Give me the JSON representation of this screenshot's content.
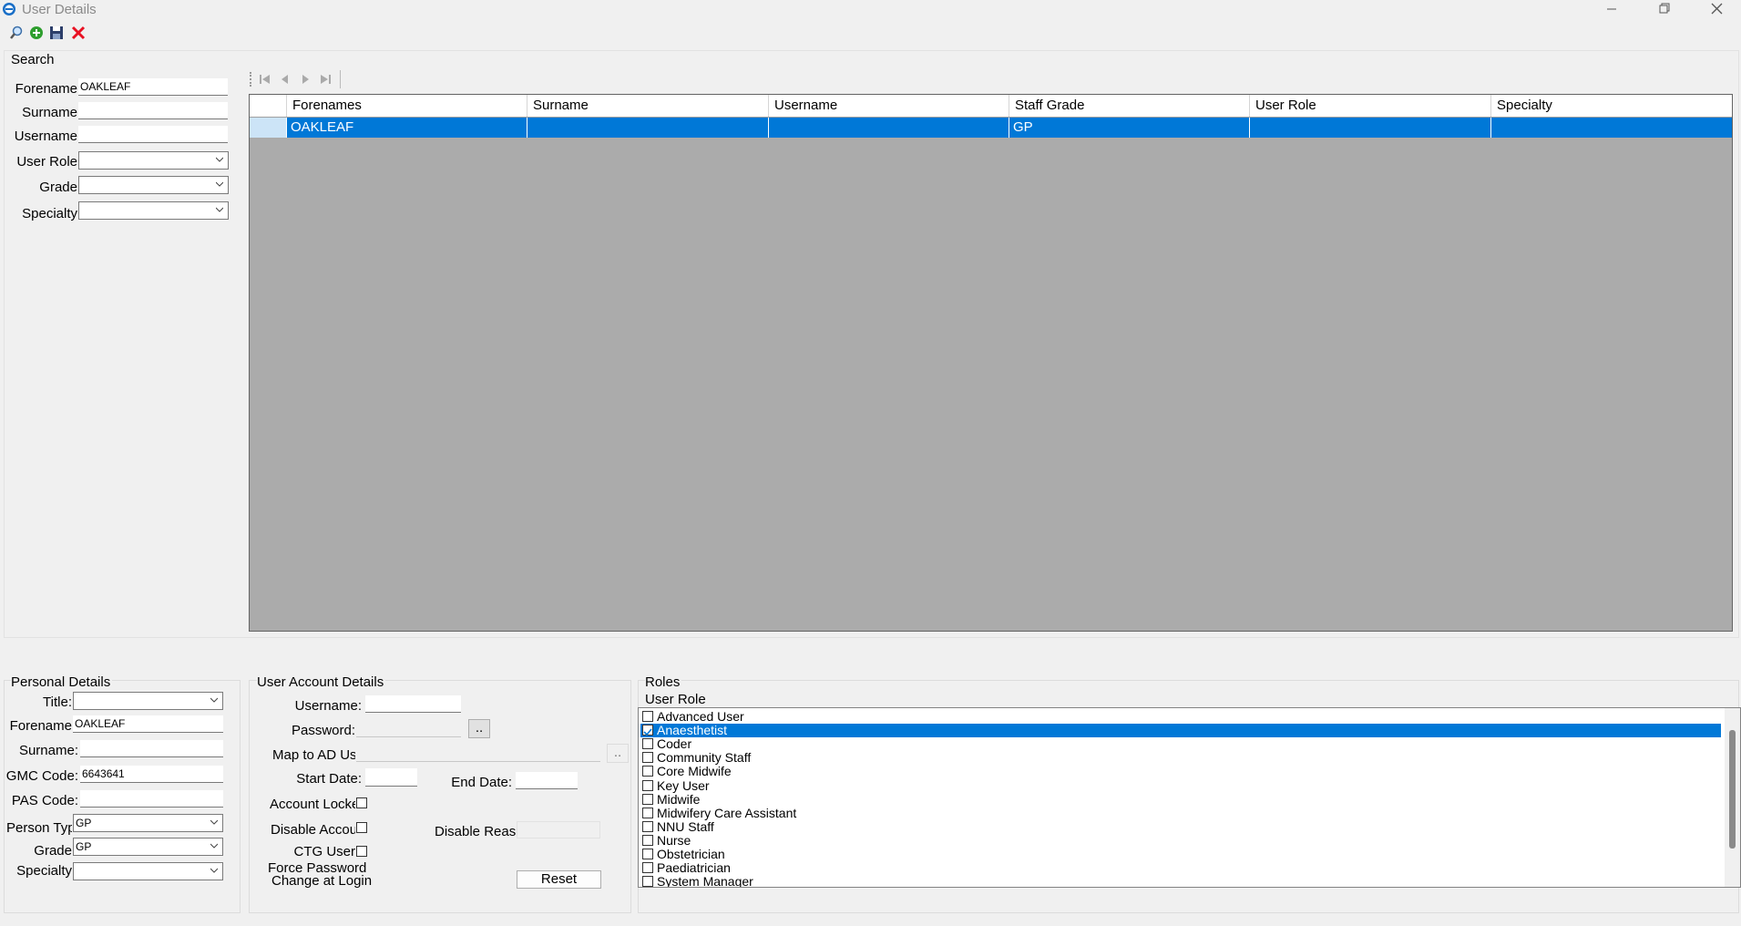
{
  "window": {
    "title": "User Details"
  },
  "search": {
    "title": "Search",
    "forename_label": "Forename",
    "forename_value": "OAKLEAF",
    "surname_label": "Surname",
    "surname_value": "",
    "username_label": "Username",
    "username_value": "",
    "user_role_label": "User Role",
    "user_role_value": "",
    "grade_label": "Grade",
    "grade_value": "",
    "specialty_label": "Specialty",
    "specialty_value": ""
  },
  "grid": {
    "columns": [
      "Forenames",
      "Surname",
      "Username",
      "Staff Grade",
      "User Role",
      "Specialty"
    ],
    "rows": [
      {
        "forenames": "OAKLEAF",
        "surname": "",
        "username": "",
        "staff_grade": "GP",
        "user_role": "",
        "specialty": ""
      }
    ]
  },
  "personal": {
    "title": "Personal Details",
    "title_label": "Title:",
    "title_value": "",
    "forename_label": "Forename",
    "forename_value": "OAKLEAF",
    "surname_label": "Surname:",
    "surname_value": "",
    "gmc_label": "GMC Code:",
    "gmc_value": "6643641",
    "pas_label": "PAS Code:",
    "pas_value": "",
    "person_type_label": "Person Type",
    "person_type_value": "GP",
    "grade_label": "Grade",
    "grade_value": "GP",
    "specialty_label": "Specialty",
    "specialty_value": ""
  },
  "account": {
    "title": "User Account Details",
    "username_label": "Username:",
    "username_value": "",
    "password_label": "Password:",
    "password_value": "",
    "password_btn": "..",
    "map_ad_label": "Map to AD User",
    "map_ad_value": "",
    "map_ad_btn": "..",
    "start_label": "Start Date:",
    "start_value": "",
    "end_label": "End Date:",
    "end_value": "",
    "locked_label": "Account Locked",
    "disable_label": "Disable Account",
    "disable_reason_label": "Disable Reason",
    "disable_reason_value": "",
    "ctg_label": "CTG User",
    "force_line1": "Force Password",
    "force_line2": "Change at Login:",
    "reset_btn": "Reset"
  },
  "roles": {
    "title": "Roles",
    "subtitle": "User Role",
    "items": [
      {
        "label": "Advanced User",
        "checked": false
      },
      {
        "label": "Anaesthetist",
        "checked": true
      },
      {
        "label": "Coder",
        "checked": false
      },
      {
        "label": "Community Staff",
        "checked": false
      },
      {
        "label": "Core Midwife",
        "checked": false
      },
      {
        "label": "Key User",
        "checked": false
      },
      {
        "label": "Midwife",
        "checked": false
      },
      {
        "label": "Midwifery Care Assistant",
        "checked": false
      },
      {
        "label": "NNU Staff",
        "checked": false
      },
      {
        "label": "Nurse",
        "checked": false
      },
      {
        "label": "Obstetrician",
        "checked": false
      },
      {
        "label": "Paediatrician",
        "checked": false
      },
      {
        "label": "System Manager",
        "checked": false
      }
    ]
  },
  "colors": {
    "accent": "#0078d7",
    "grid_bg": "#ababab",
    "window_bg": "#f0f0f0",
    "delete": "#e81123",
    "add": "#2e9e2e"
  }
}
